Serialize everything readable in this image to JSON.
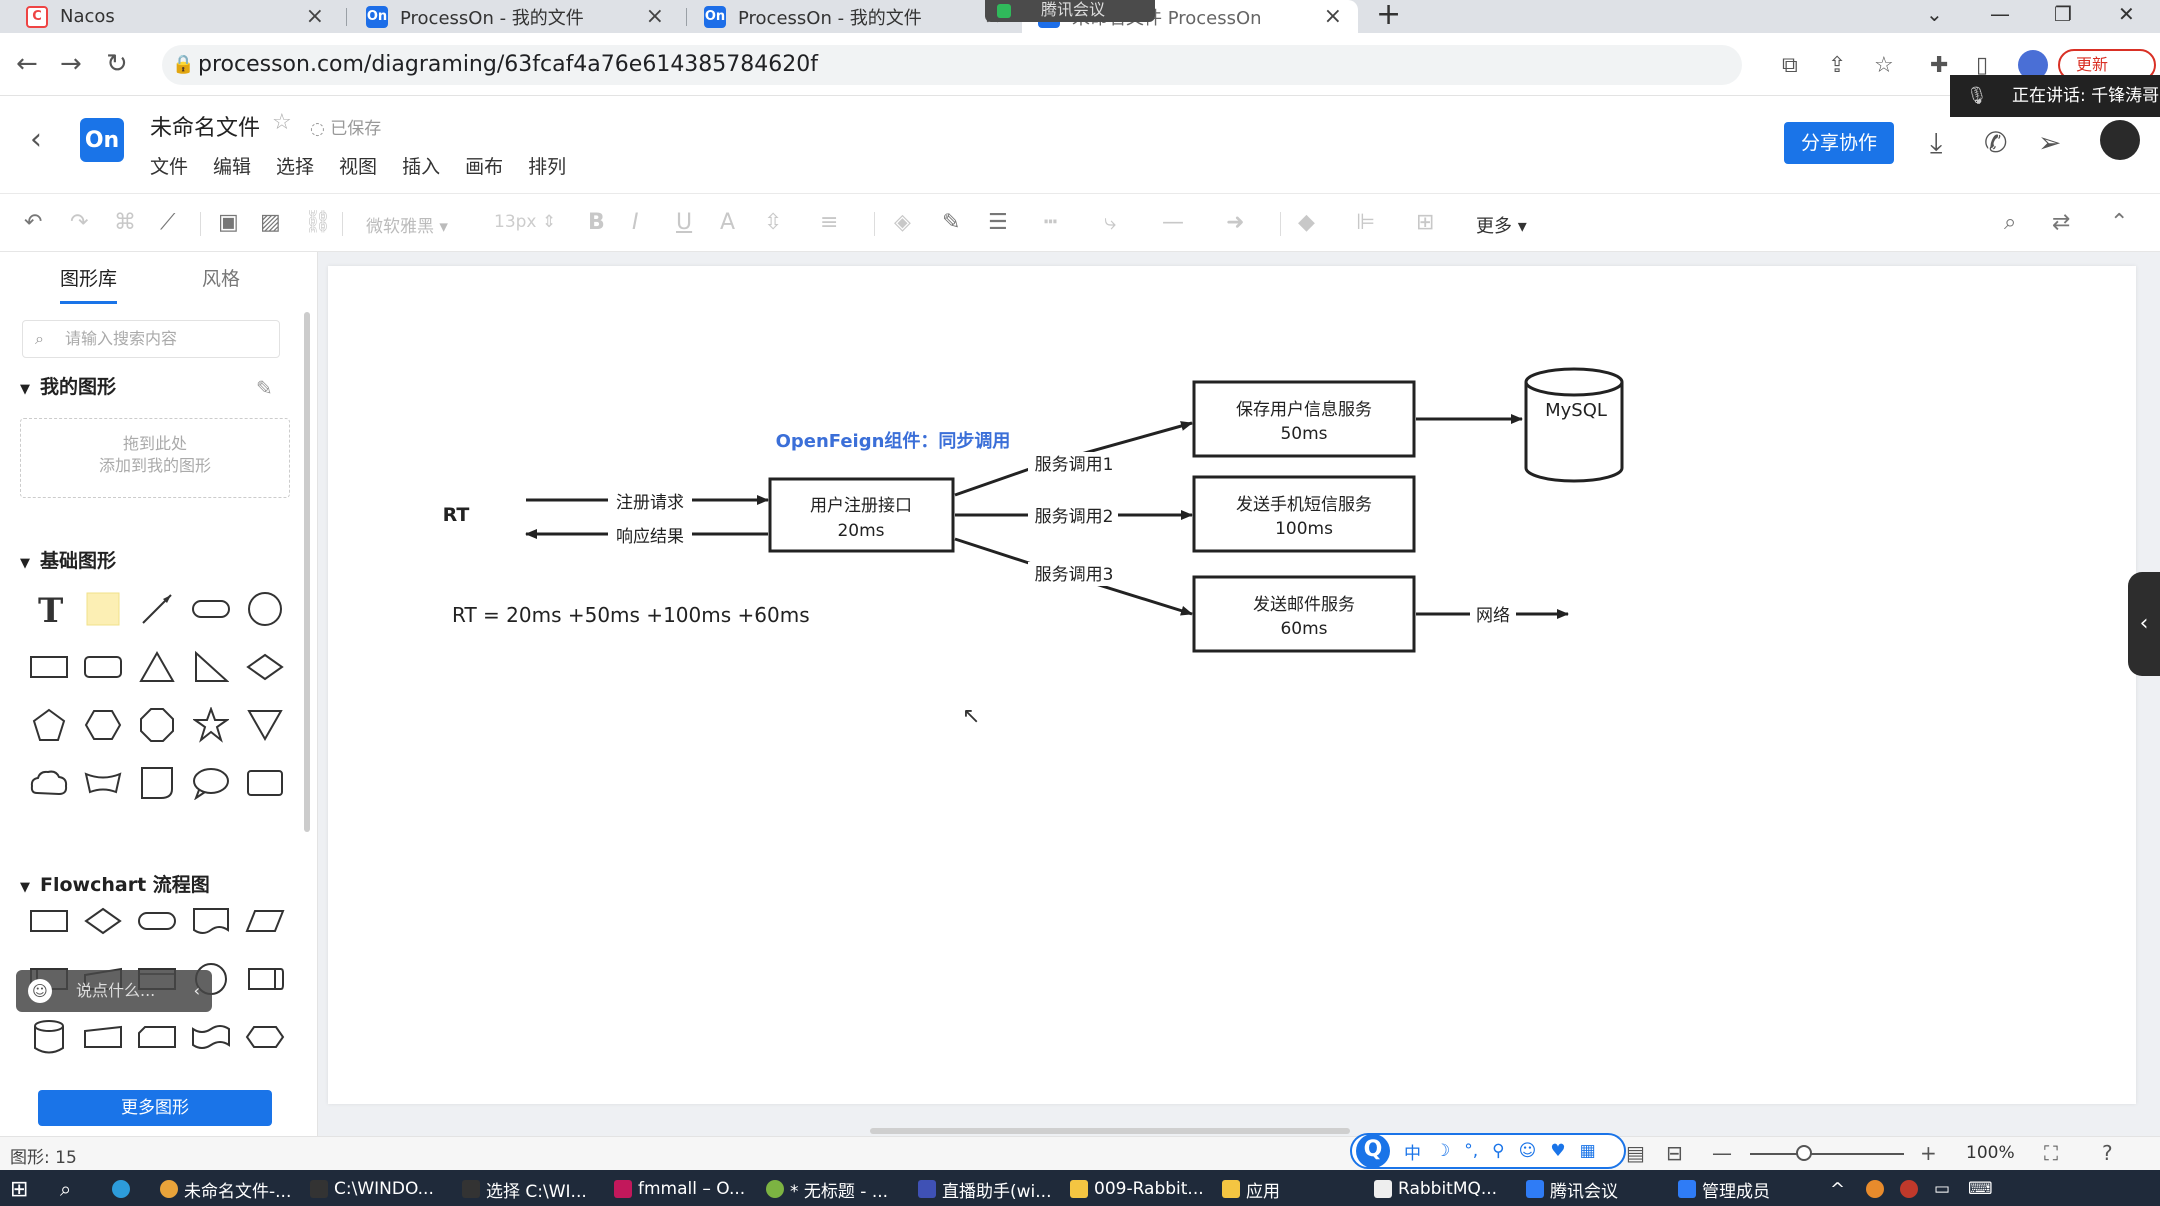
{
  "browser": {
    "tabs": [
      {
        "label": "Nacos",
        "icon": "nacos-favicon",
        "fav_text": "C"
      },
      {
        "label": "ProcessOn - 我的文件",
        "icon": "processon-favicon",
        "fav_text": "On"
      },
      {
        "label": "ProcessOn - 我的文件",
        "icon": "processon-favicon",
        "fav_text": "On"
      },
      {
        "label": "未命名文件 ProcessOn",
        "icon": "processon-favicon",
        "fav_text": "On"
      }
    ],
    "meeting_overlay": "腾讯会议",
    "url": "processon.com/diagraming/63fcaf4a76e614385784620f",
    "update_label": "更新",
    "speaking_label": "正在讲话: 千锋涛哥"
  },
  "app": {
    "logo_text": "On",
    "doc_title": "未命名文件",
    "saved_status": "已保存",
    "menu": [
      "文件",
      "编辑",
      "选择",
      "视图",
      "插入",
      "画布",
      "排列"
    ],
    "share_label": "分享协作"
  },
  "toolbar": {
    "font_name": "微软雅黑",
    "font_size": "13px",
    "more_label": "更多"
  },
  "left_panel": {
    "tabs": [
      "图形库",
      "风格"
    ],
    "search_placeholder": "请输入搜索内容",
    "my_shapes_title": "我的图形",
    "drop_hint_1": "拖到此处",
    "drop_hint_2": "添加到我的图形",
    "basic_shapes_title": "基础图形",
    "flowchart_title": "Flowchart 流程图",
    "chat_placeholder": "说点什么...",
    "more_shapes_label": "更多图形"
  },
  "diagram": {
    "rt_label": "RT",
    "request_label": "注册请求",
    "response_label": "响应结果",
    "openfeign_label": "OpenFeign组件：同步调用",
    "register_box": [
      "用户注册接口",
      "20ms"
    ],
    "call1": "服务调用1",
    "call2": "服务调用2",
    "call3": "服务调用3",
    "save_box": [
      "保存用户信息服务",
      "50ms"
    ],
    "sms_box": [
      "发送手机短信服务",
      "100ms"
    ],
    "mail_box": [
      "发送邮件服务",
      "60ms"
    ],
    "mysql_label": "MySQL",
    "network_label": "网络",
    "formula": "RT = 20ms +50ms +100ms +60ms",
    "accent_color": "#3b6fd8"
  },
  "status": {
    "shape_count": "图形: 15",
    "zoom": "100%",
    "ime_chars": [
      "中",
      "☽",
      "°,",
      "⚲",
      "☺",
      "♥",
      "▦"
    ]
  },
  "taskbar": {
    "items": [
      "未命名文件-...",
      "C:\\WINDO...",
      "选择 C:\\WI...",
      "fmmall – O...",
      "* 无标题 - ...",
      "直播助手(wi...",
      "009-Rabbit...",
      "应用",
      "RabbitMQ...",
      "腾讯会议",
      "管理成员"
    ]
  }
}
